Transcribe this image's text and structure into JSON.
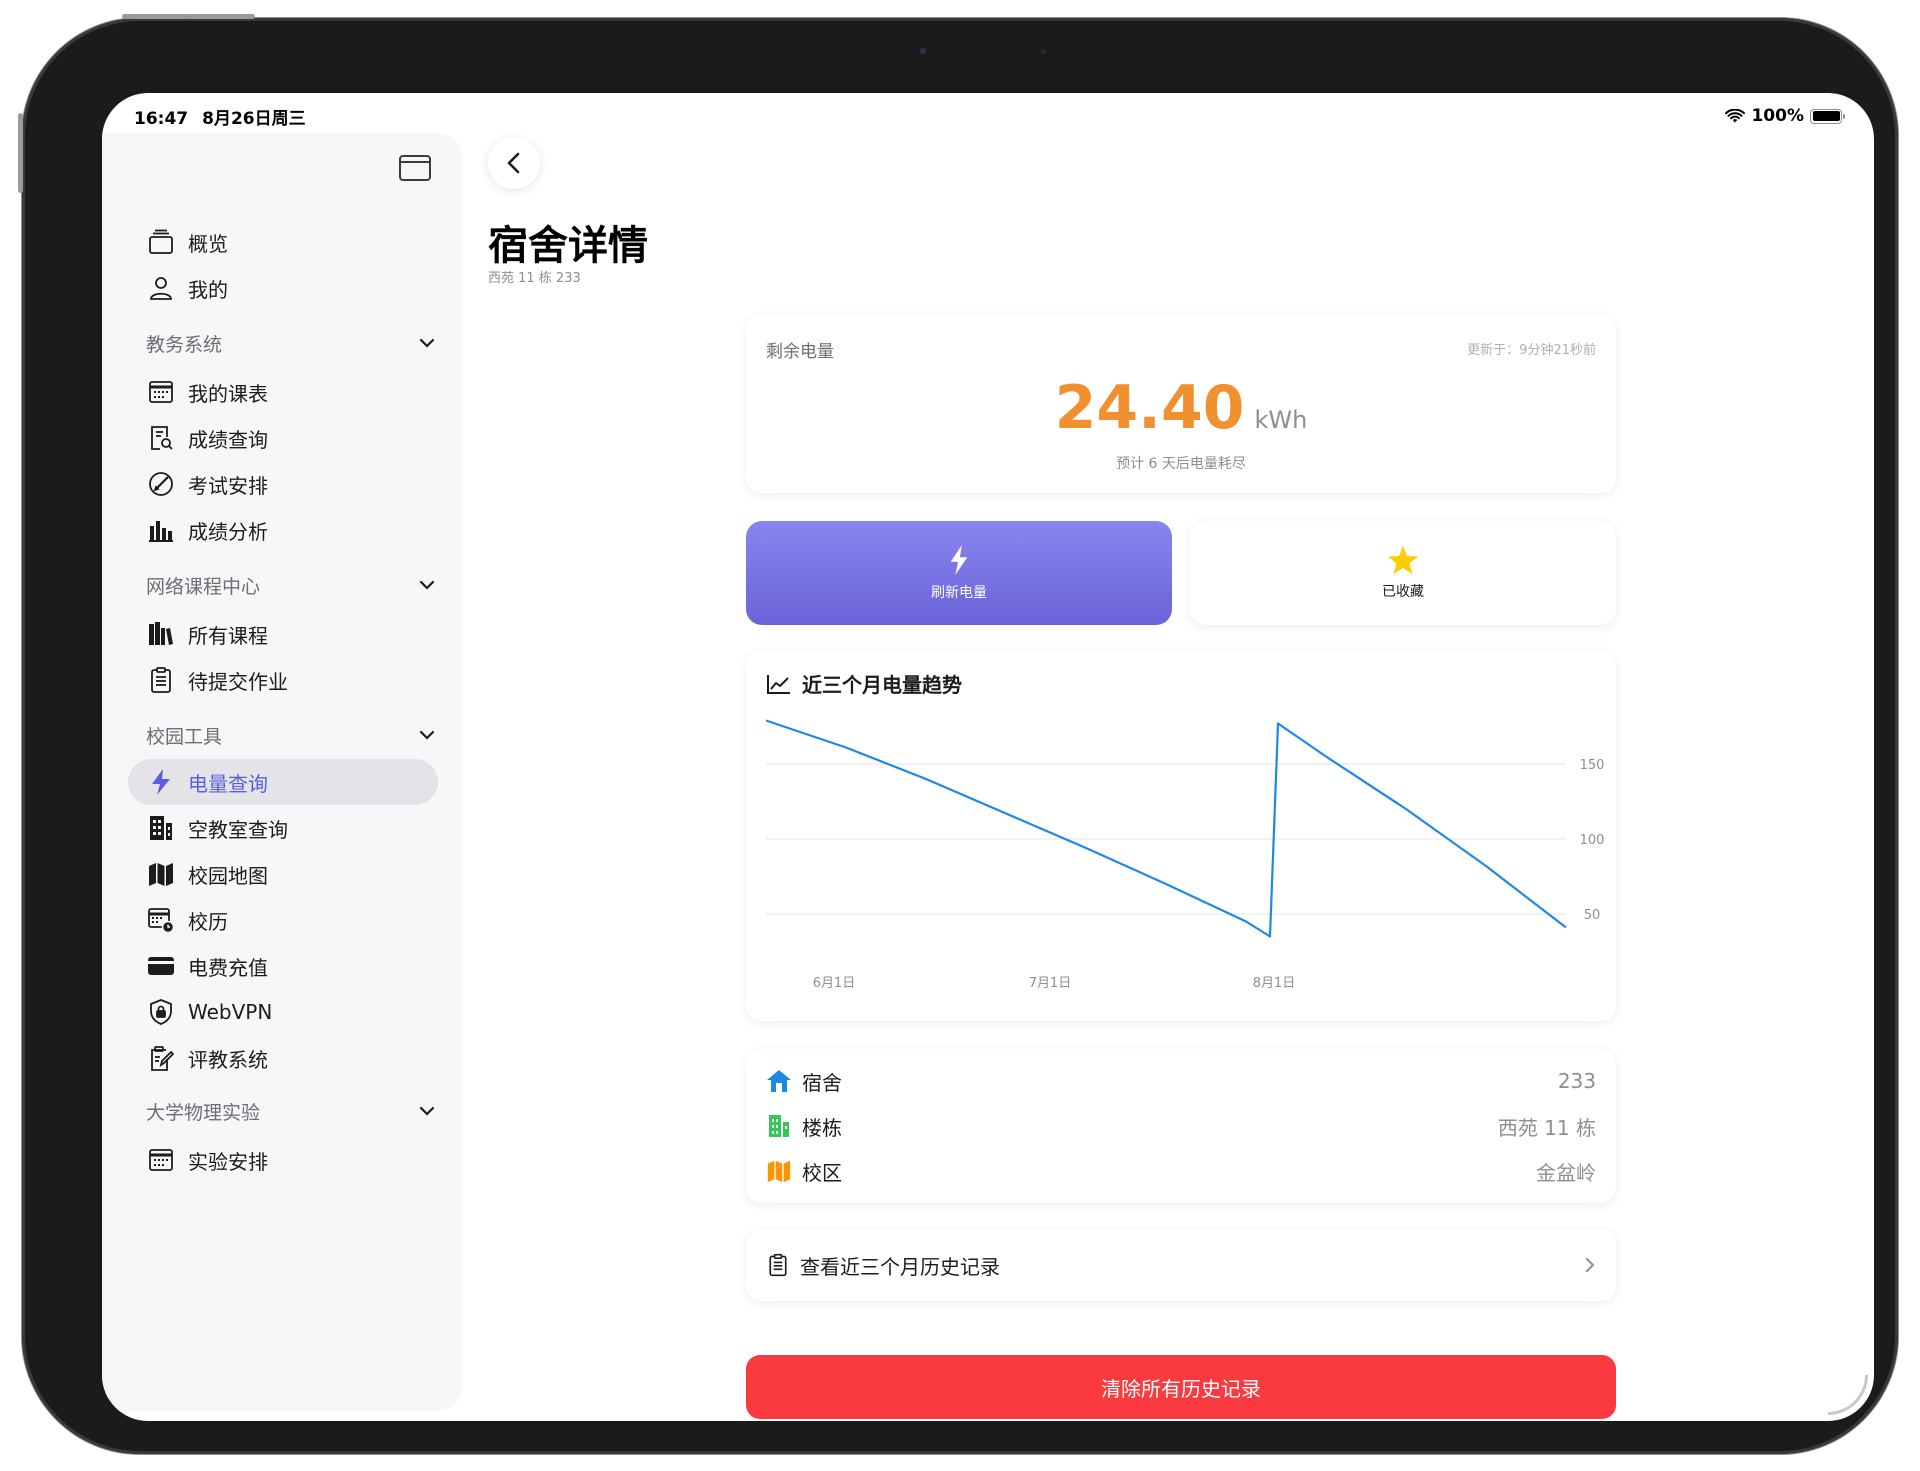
{
  "status_bar": {
    "time": "16:47",
    "date": "8月26日周三",
    "battery": "100%"
  },
  "sidebar": {
    "top_items": [
      {
        "label": "概览",
        "icon": "overview-icon"
      },
      {
        "label": "我的",
        "icon": "person-icon"
      }
    ],
    "sections": [
      {
        "title": "教务系统",
        "items": [
          {
            "label": "我的课表",
            "icon": "calendar-icon"
          },
          {
            "label": "成绩查询",
            "icon": "grade-search-icon"
          },
          {
            "label": "考试安排",
            "icon": "exam-icon"
          },
          {
            "label": "成绩分析",
            "icon": "bar-chart-icon"
          }
        ]
      },
      {
        "title": "网络课程中心",
        "items": [
          {
            "label": "所有课程",
            "icon": "books-icon"
          },
          {
            "label": "待提交作业",
            "icon": "clipboard-icon"
          }
        ]
      },
      {
        "title": "校园工具",
        "items": [
          {
            "label": "电量查询",
            "icon": "bolt-icon",
            "active": true
          },
          {
            "label": "空教室查询",
            "icon": "building-icon"
          },
          {
            "label": "校园地图",
            "icon": "map-icon"
          },
          {
            "label": "校历",
            "icon": "calendar-clock-icon"
          },
          {
            "label": "电费充值",
            "icon": "credit-card-icon"
          },
          {
            "label": "WebVPN",
            "icon": "shield-lock-icon"
          },
          {
            "label": "评教系统",
            "icon": "edit-note-icon"
          }
        ]
      },
      {
        "title": "大学物理实验",
        "items": [
          {
            "label": "实验安排",
            "icon": "calendar-icon"
          }
        ]
      }
    ]
  },
  "page": {
    "title": "宿舍详情",
    "subtitle": "西苑 11 栋 233"
  },
  "balance": {
    "label": "剩余电量",
    "updated": "更新于：9分钟21秒前",
    "value": "24.40",
    "unit": "kWh",
    "estimate": "预计 6 天后电量耗尽",
    "value_color": "#f0902f"
  },
  "actions": {
    "refresh_label": "刷新电量",
    "favorite_label": "已收藏"
  },
  "chart_title": "近三个月电量趋势",
  "chart_data": {
    "type": "line",
    "x_ticks": [
      "6月1日",
      "7月1日",
      "8月1日"
    ],
    "y_ticks": [
      50,
      100,
      150
    ],
    "ylim": [
      20,
      180
    ],
    "series": [
      {
        "color": "#1e88e5",
        "x": [
          0,
          10,
          20,
          30,
          40,
          50,
          60,
          63,
          64,
          70,
          80,
          90,
          100
        ],
        "y": [
          179,
          161,
          140,
          117,
          94,
          70,
          45,
          35,
          177,
          155,
          120,
          82,
          41
        ]
      }
    ]
  },
  "info": [
    {
      "label": "宿舍",
      "value": "233",
      "icon": "house-icon",
      "color": "#1e88e5"
    },
    {
      "label": "楼栋",
      "value": "西苑 11 栋",
      "icon": "building-icon",
      "color": "#34c759"
    },
    {
      "label": "校区",
      "value": "金盆岭",
      "icon": "map-icon",
      "color": "#ff9500"
    }
  ],
  "history_label": "查看近三个月历史记录",
  "clear_label": "清除所有历史记录"
}
